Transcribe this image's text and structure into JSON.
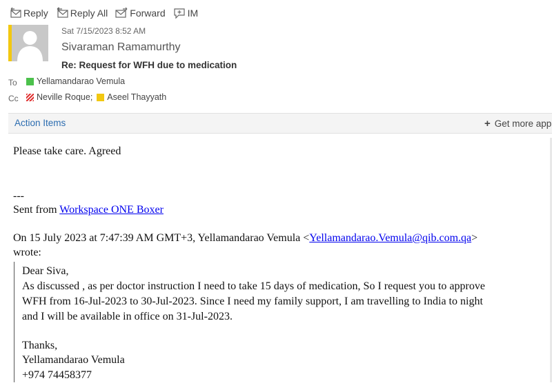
{
  "toolbar": {
    "reply": "Reply",
    "reply_all": "Reply All",
    "forward": "Forward",
    "im": "IM"
  },
  "header": {
    "date": "Sat 7/15/2023 8:52 AM",
    "sender": "Sivaraman Ramamurthy",
    "subject": "Re: Request for WFH due to medication",
    "to_label": "To",
    "cc_label": "Cc",
    "to": [
      {
        "name": "Yellamandarao Vemula",
        "color": "#4cc14c"
      }
    ],
    "cc": [
      {
        "name": "Neville Roque;",
        "color": "#e03030"
      },
      {
        "name": "Aseel Thayyath",
        "color": "#f2c811"
      }
    ]
  },
  "action_bar": {
    "action_items": "Action Items",
    "get_more": "Get more app"
  },
  "message": {
    "line1": "Please take care. Agreed",
    "sep": "---",
    "sent_from_prefix": "Sent from ",
    "sent_from_link": "Workspace ONE Boxer",
    "on_prefix": "On 15 July 2023 at 7:47:39 AM GMT+3, Yellamandarao Vemula <",
    "on_email": "Yellamandarao.Vemula@qib.com.qa",
    "on_suffix": ">",
    "wrote": "wrote:",
    "quote": {
      "greeting": "Dear Siva,",
      "p1": "As discussed , as per doctor instruction I need to take 15 days of medication, So I request you to approve",
      "p2": "WFH from 16-Jul-2023 to 30-Jul-2023. Since I need my family support, I am travelling to India to night",
      "p3": "and I will be available in office on 31-Jul-2023.",
      "thanks": "Thanks,",
      "sig_name": "Yellamandarao Vemula",
      "sig_phone": "+974 74458377"
    }
  }
}
